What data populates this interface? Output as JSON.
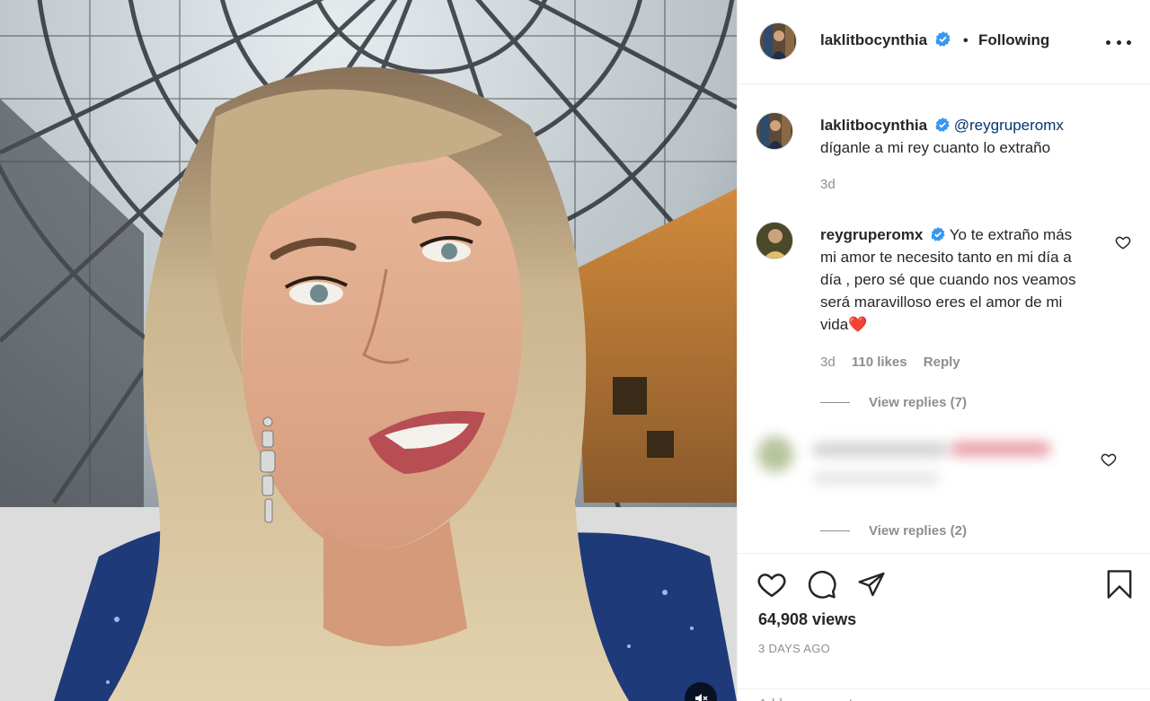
{
  "post": {
    "author": "laklitbocynthia",
    "follow_status": "Following",
    "caption_mention": "@reygruperomx",
    "caption_text": "díganle a mi rey cuanto lo extraño",
    "caption_time": "3d"
  },
  "comments": [
    {
      "username": "reygruperomx",
      "text": "Yo te extraño más mi amor te necesito tanto en mi día a día , pero sé que cuando nos veamos será maravilloso eres el amor de mi vida",
      "emoji": "❤️",
      "time": "3d",
      "likes": "110 likes",
      "reply_label": "Reply",
      "view_replies": "View replies (7)"
    },
    {
      "view_replies": "View replies (2)"
    }
  ],
  "stats": {
    "views": "64,908 views",
    "time_ago": "3 DAYS AGO"
  },
  "add_comment_placeholder": "Add a comment...",
  "colors": {
    "text": "#262626",
    "muted": "#8e8e8e",
    "verified": "#3897f0",
    "link": "#00376b",
    "heart": "#ed4956"
  }
}
